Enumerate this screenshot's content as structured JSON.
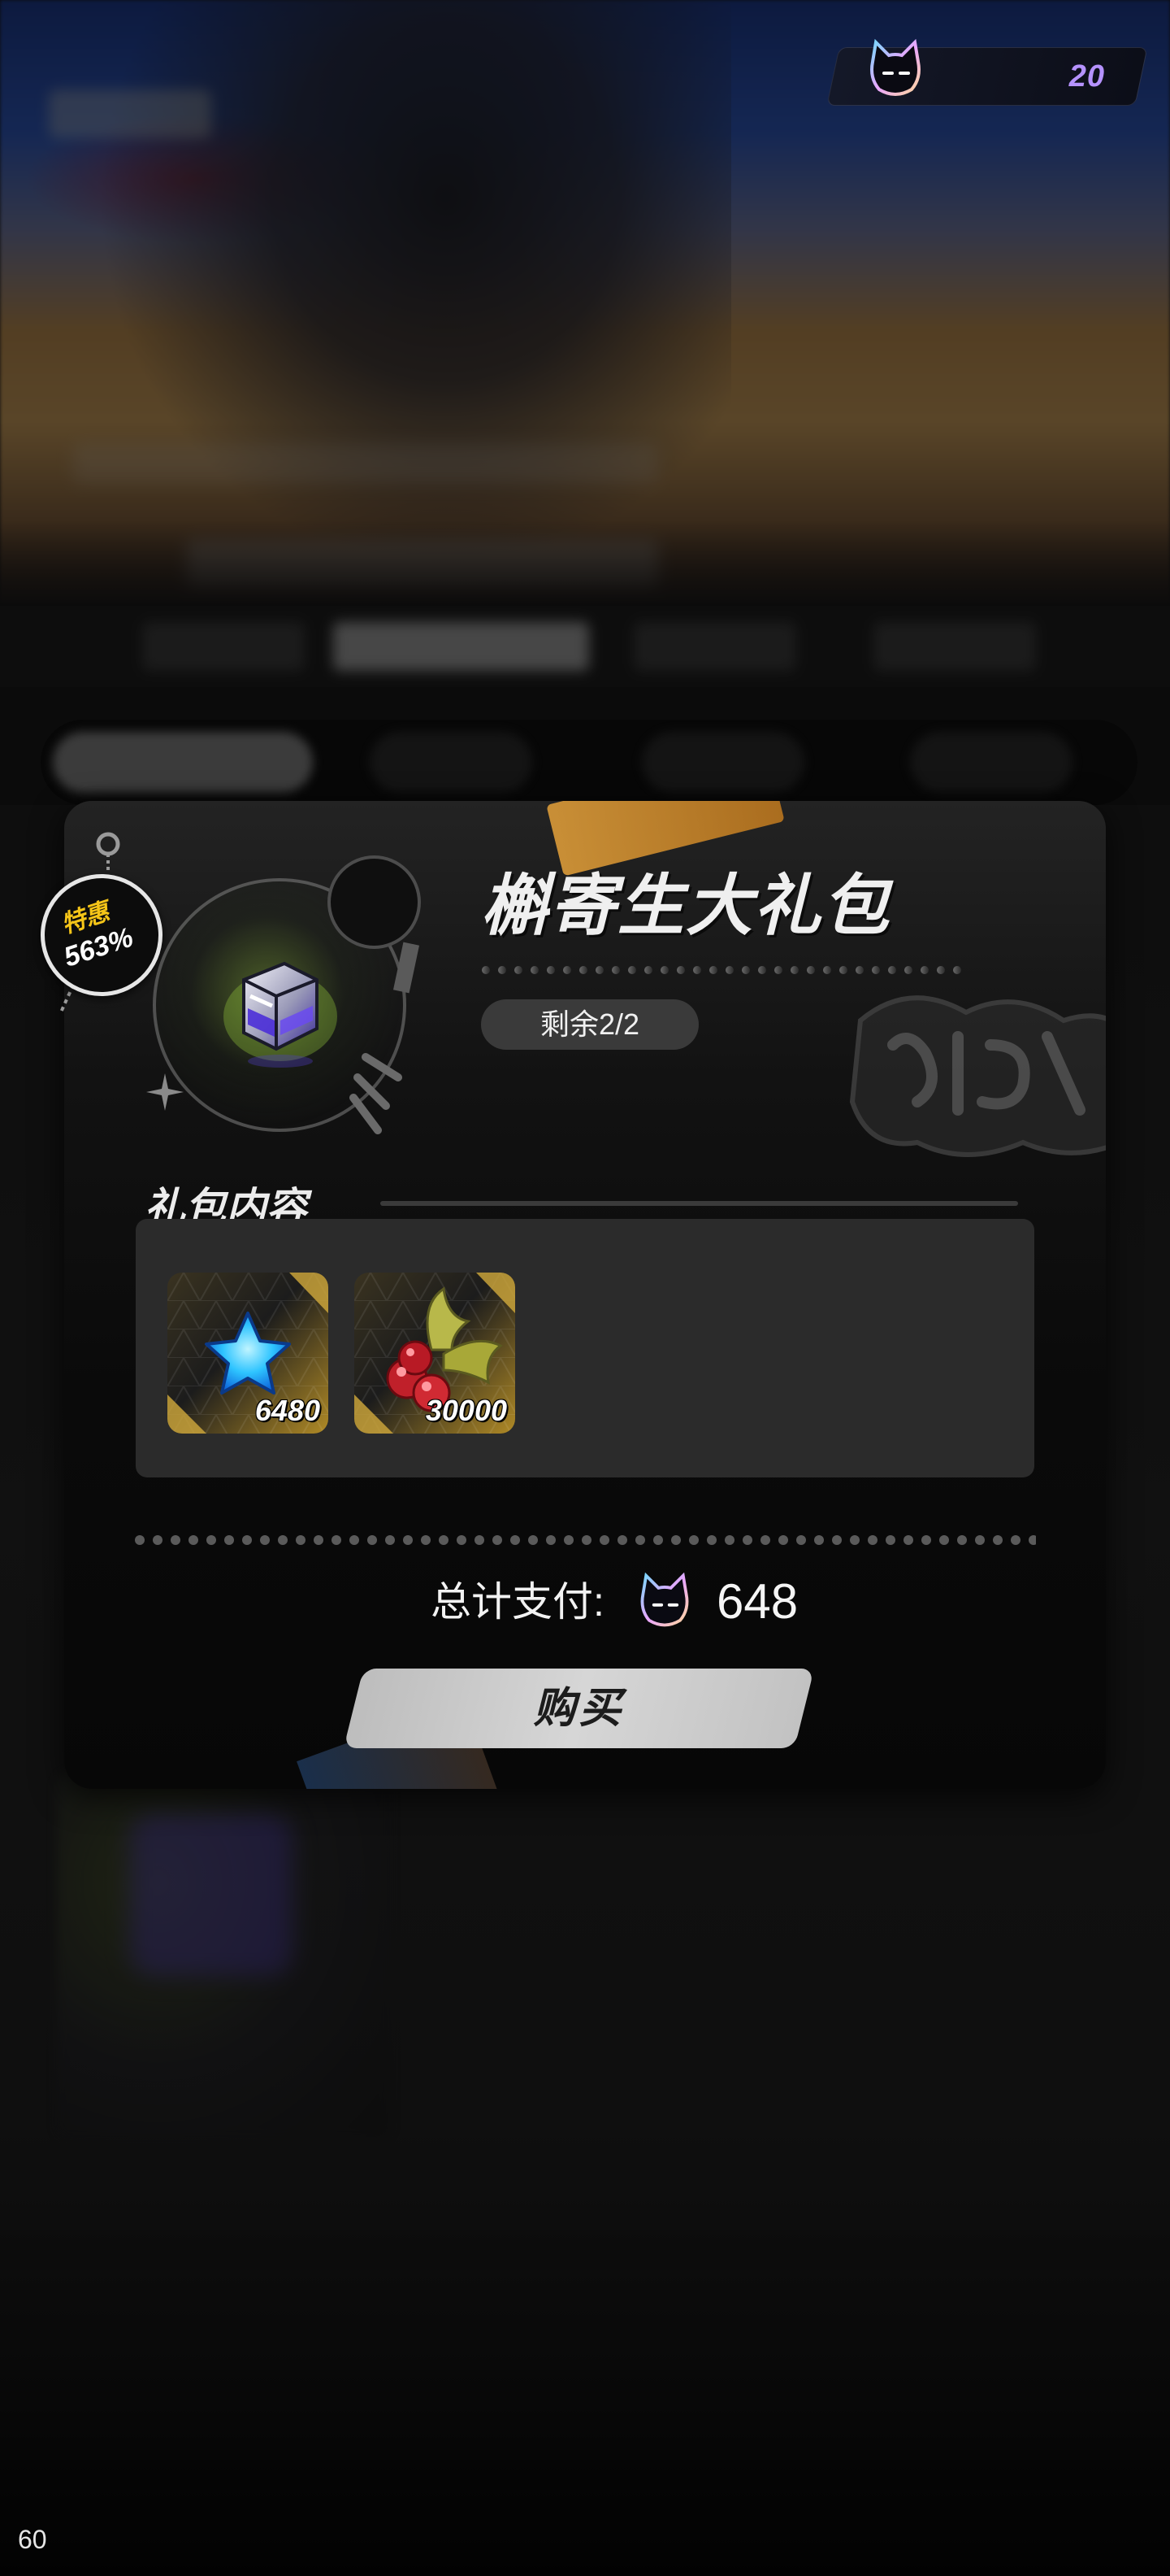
{
  "currency": {
    "amount": "20",
    "icon": "cat-head-icon",
    "accent": "#b592ff"
  },
  "gift": {
    "badge": {
      "top": "特惠",
      "bottom": "563%"
    },
    "title": "槲寄生大礼包",
    "remaining": "剩余2/2",
    "product_icon": "equipment-box-icon"
  },
  "contents": {
    "title": "礼包内容",
    "items": [
      {
        "icon": "blue-star-crystal-icon",
        "quantity": "6480"
      },
      {
        "icon": "mistletoe-berries-icon",
        "quantity": "30000"
      }
    ]
  },
  "total": {
    "label": "总计支付:",
    "value": "648",
    "icon": "cat-head-icon"
  },
  "buy": {
    "label": "购买"
  },
  "fps": "60",
  "colors": {
    "badge_gold": "#f5c518",
    "button": "#cfcfcf",
    "panel": "#2b2b2b"
  }
}
